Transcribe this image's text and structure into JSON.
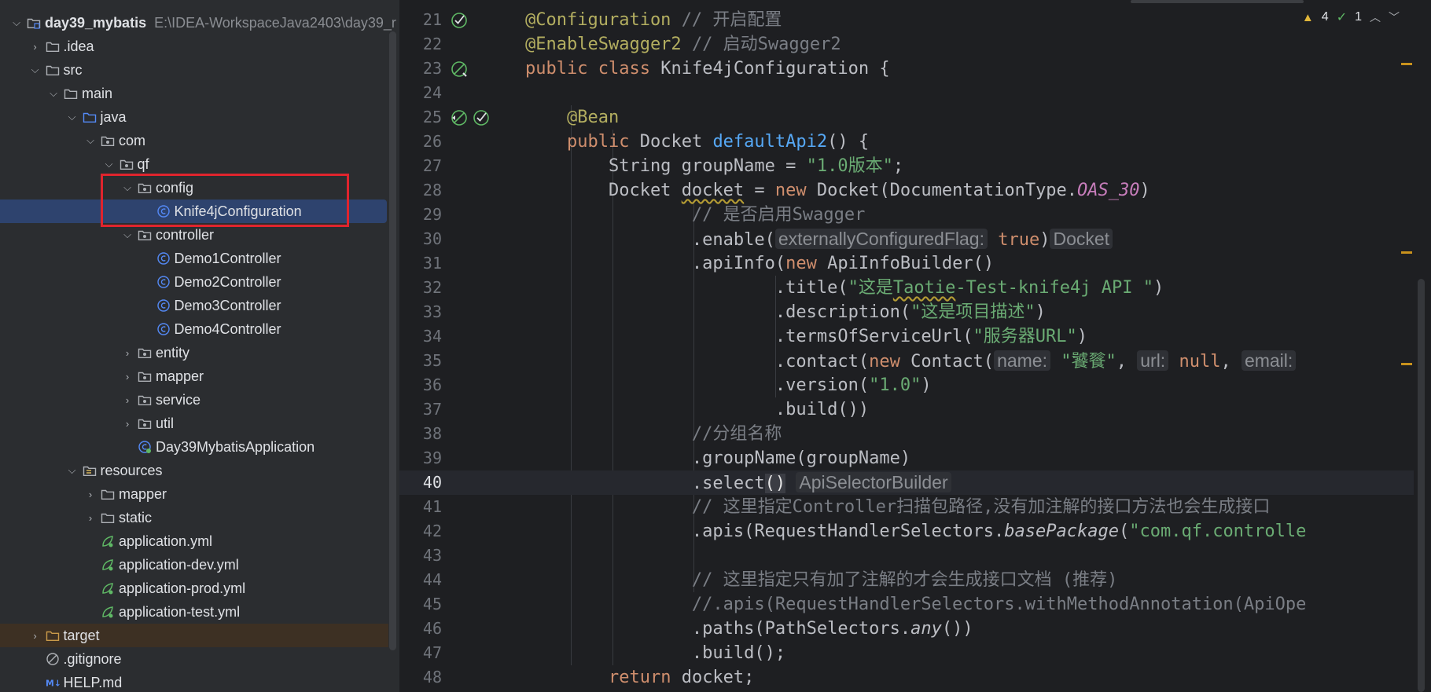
{
  "project": {
    "name": "day39_mybatis",
    "path": "E:\\IDEA-WorkspaceJava2403\\day39_r"
  },
  "tree": [
    {
      "label": "day39_mybatis",
      "indent": 0,
      "chevron": "down",
      "icon": "module-icon",
      "bold": true,
      "path": "E:\\IDEA-WorkspaceJava2403\\day39_r"
    },
    {
      "label": ".idea",
      "indent": 1,
      "chevron": "right",
      "icon": "folder-icon"
    },
    {
      "label": "src",
      "indent": 1,
      "chevron": "down",
      "icon": "folder-icon"
    },
    {
      "label": "main",
      "indent": 2,
      "chevron": "down",
      "icon": "folder-icon"
    },
    {
      "label": "java",
      "indent": 3,
      "chevron": "down",
      "icon": "source-folder-icon"
    },
    {
      "label": "com",
      "indent": 4,
      "chevron": "down",
      "icon": "package-icon"
    },
    {
      "label": "qf",
      "indent": 5,
      "chevron": "down",
      "icon": "package-icon"
    },
    {
      "label": "config",
      "indent": 6,
      "chevron": "down",
      "icon": "package-icon"
    },
    {
      "label": "Knife4jConfiguration",
      "indent": 7,
      "chevron": "none",
      "icon": "class-icon",
      "selected": true
    },
    {
      "label": "controller",
      "indent": 6,
      "chevron": "down",
      "icon": "package-icon"
    },
    {
      "label": "Demo1Controller",
      "indent": 7,
      "chevron": "none",
      "icon": "class-icon"
    },
    {
      "label": "Demo2Controller",
      "indent": 7,
      "chevron": "none",
      "icon": "class-icon"
    },
    {
      "label": "Demo3Controller",
      "indent": 7,
      "chevron": "none",
      "icon": "class-icon"
    },
    {
      "label": "Demo4Controller",
      "indent": 7,
      "chevron": "none",
      "icon": "class-icon"
    },
    {
      "label": "entity",
      "indent": 6,
      "chevron": "right",
      "icon": "package-icon"
    },
    {
      "label": "mapper",
      "indent": 6,
      "chevron": "right",
      "icon": "package-icon"
    },
    {
      "label": "service",
      "indent": 6,
      "chevron": "right",
      "icon": "package-icon"
    },
    {
      "label": "util",
      "indent": 6,
      "chevron": "right",
      "icon": "package-icon"
    },
    {
      "label": "Day39MybatisApplication",
      "indent": 6,
      "chevron": "none",
      "icon": "spring-class-icon"
    },
    {
      "label": "resources",
      "indent": 3,
      "chevron": "down",
      "icon": "resources-folder-icon"
    },
    {
      "label": "mapper",
      "indent": 4,
      "chevron": "right",
      "icon": "folder-icon"
    },
    {
      "label": "static",
      "indent": 4,
      "chevron": "right",
      "icon": "folder-icon"
    },
    {
      "label": "application.yml",
      "indent": 4,
      "chevron": "none",
      "icon": "yaml-icon"
    },
    {
      "label": "application-dev.yml",
      "indent": 4,
      "chevron": "none",
      "icon": "yaml-icon"
    },
    {
      "label": "application-prod.yml",
      "indent": 4,
      "chevron": "none",
      "icon": "yaml-icon"
    },
    {
      "label": "application-test.yml",
      "indent": 4,
      "chevron": "none",
      "icon": "yaml-icon"
    },
    {
      "label": "target",
      "indent": 1,
      "chevron": "right",
      "icon": "excluded-folder-icon",
      "excluded": true
    },
    {
      "label": ".gitignore",
      "indent": 1,
      "chevron": "none",
      "icon": "ignore-icon"
    },
    {
      "label": "HELP.md",
      "indent": 1,
      "chevron": "none",
      "icon": "markdown-icon"
    }
  ],
  "editor": {
    "status": {
      "warnings": "4",
      "checks": "1"
    },
    "current_line": 40,
    "lines": [
      {
        "n": "21",
        "gutter": [
          "bean-check-icon"
        ],
        "tokens": [
          [
            "@Configuration",
            "ann"
          ],
          [
            " ",
            "p"
          ],
          [
            "// 开启配置",
            "cm"
          ]
        ]
      },
      {
        "n": "22",
        "gutter": [],
        "tokens": [
          [
            "@EnableSwagger2",
            "ann"
          ],
          [
            " ",
            "p"
          ],
          [
            "// 启动Swagger2",
            "cm"
          ]
        ]
      },
      {
        "n": "23",
        "gutter": [
          "bean-config-icon"
        ],
        "tokens": [
          [
            "public",
            "kw"
          ],
          [
            " ",
            "p"
          ],
          [
            "class",
            "kw"
          ],
          [
            " Knife4jConfiguration {",
            "p"
          ]
        ]
      },
      {
        "n": "24",
        "gutter": [],
        "tokens": []
      },
      {
        "n": "25",
        "gutter": [
          "bean-nav-icon",
          "bean-check-icon"
        ],
        "tokens": [
          [
            "    ",
            "p"
          ],
          [
            "@Bean",
            "ann"
          ]
        ]
      },
      {
        "n": "26",
        "gutter": [],
        "tokens": [
          [
            "    ",
            "p"
          ],
          [
            "public",
            "kw"
          ],
          [
            " Docket ",
            "p"
          ],
          [
            "defaultApi2",
            "fn"
          ],
          [
            "() {",
            "p"
          ]
        ]
      },
      {
        "n": "27",
        "gutter": [],
        "tokens": [
          [
            "        String groupName = ",
            "p"
          ],
          [
            "\"1.0版本\"",
            "str"
          ],
          [
            ";",
            "p"
          ]
        ]
      },
      {
        "n": "28",
        "gutter": [],
        "tokens": [
          [
            "        Docket ",
            "p"
          ],
          [
            "docket",
            "sq"
          ],
          [
            " = ",
            "p"
          ],
          [
            "new",
            "kw"
          ],
          [
            " Docket(DocumentationType.",
            "p"
          ],
          [
            "OAS_30",
            "const"
          ],
          [
            ")",
            "p"
          ]
        ]
      },
      {
        "n": "29",
        "gutter": [],
        "tokens": [
          [
            "                ",
            "p"
          ],
          [
            "// 是否启用Swagger",
            "cm"
          ]
        ]
      },
      {
        "n": "30",
        "gutter": [],
        "tokens": [
          [
            "                .enable(",
            "p"
          ],
          [
            "externallyConfiguredFlag:",
            "hint"
          ],
          [
            " ",
            "p"
          ],
          [
            "true",
            "kw"
          ],
          [
            ")",
            "p"
          ],
          [
            "Docket",
            "hint"
          ]
        ]
      },
      {
        "n": "31",
        "gutter": [],
        "tokens": [
          [
            "                .apiInfo(",
            "p"
          ],
          [
            "new",
            "kw"
          ],
          [
            " ApiInfoBuilder()",
            "p"
          ]
        ]
      },
      {
        "n": "32",
        "gutter": [],
        "tokens": [
          [
            "                        .title(",
            "p"
          ],
          [
            "\"这是",
            "str"
          ],
          [
            "Taotie",
            "strsq"
          ],
          [
            "-Test-knife4j API \"",
            "str"
          ],
          [
            ")",
            "p"
          ]
        ]
      },
      {
        "n": "33",
        "gutter": [],
        "tokens": [
          [
            "                        .description(",
            "p"
          ],
          [
            "\"这是项目描述\"",
            "str"
          ],
          [
            ")",
            "p"
          ]
        ]
      },
      {
        "n": "34",
        "gutter": [],
        "tokens": [
          [
            "                        .termsOfServiceUrl(",
            "p"
          ],
          [
            "\"服务器URL\"",
            "str"
          ],
          [
            ")",
            "p"
          ]
        ]
      },
      {
        "n": "35",
        "gutter": [],
        "tokens": [
          [
            "                        .contact(",
            "p"
          ],
          [
            "new",
            "kw"
          ],
          [
            " Contact(",
            "p"
          ],
          [
            "name:",
            "hint"
          ],
          [
            " ",
            "p"
          ],
          [
            "\"饕餮\"",
            "str"
          ],
          [
            ", ",
            "p"
          ],
          [
            "url:",
            "hint"
          ],
          [
            " ",
            "p"
          ],
          [
            "null",
            "kw"
          ],
          [
            ", ",
            "p"
          ],
          [
            "email:",
            "hint"
          ]
        ]
      },
      {
        "n": "36",
        "gutter": [],
        "tokens": [
          [
            "                        .version(",
            "p"
          ],
          [
            "\"1.0\"",
            "str"
          ],
          [
            ")",
            "p"
          ]
        ]
      },
      {
        "n": "37",
        "gutter": [],
        "tokens": [
          [
            "                        .build())",
            "p"
          ]
        ]
      },
      {
        "n": "38",
        "gutter": [],
        "tokens": [
          [
            "                ",
            "p"
          ],
          [
            "//分组名称",
            "cm"
          ]
        ]
      },
      {
        "n": "39",
        "gutter": [],
        "tokens": [
          [
            "                .groupName(groupName)",
            "p"
          ]
        ]
      },
      {
        "n": "40",
        "gutter": [],
        "tokens": [
          [
            "                .select",
            "p"
          ],
          [
            "()",
            "br"
          ],
          [
            " ",
            "p"
          ],
          [
            "ApiSelectorBuilder",
            "hint"
          ]
        ]
      },
      {
        "n": "41",
        "gutter": [],
        "tokens": [
          [
            "                ",
            "p"
          ],
          [
            "// 这里指定Controller扫描包路径,没有加注解的接口方法也会生成接口",
            "cm"
          ]
        ]
      },
      {
        "n": "42",
        "gutter": [],
        "tokens": [
          [
            "                .apis(RequestHandlerSelectors.",
            "p"
          ],
          [
            "basePackage",
            "it"
          ],
          [
            "(",
            "p"
          ],
          [
            "\"com.qf.controlle",
            "str"
          ]
        ]
      },
      {
        "n": "43",
        "gutter": [],
        "tokens": []
      },
      {
        "n": "44",
        "gutter": [],
        "tokens": [
          [
            "                ",
            "p"
          ],
          [
            "// 这里指定只有加了注解的才会生成接口文档 (推荐)",
            "cm"
          ]
        ]
      },
      {
        "n": "45",
        "gutter": [],
        "tokens": [
          [
            "                ",
            "p"
          ],
          [
            "//.apis(RequestHandlerSelectors.withMethodAnnotation(ApiOpe",
            "cm"
          ]
        ]
      },
      {
        "n": "46",
        "gutter": [],
        "tokens": [
          [
            "                .paths(PathSelectors.",
            "p"
          ],
          [
            "any",
            "it"
          ],
          [
            "())",
            "p"
          ]
        ]
      },
      {
        "n": "47",
        "gutter": [],
        "tokens": [
          [
            "                .build();",
            "p"
          ]
        ]
      },
      {
        "n": "48",
        "gutter": [],
        "tokens": [
          [
            "        ",
            "p"
          ],
          [
            "return",
            "kw"
          ],
          [
            " docket;",
            "p"
          ]
        ]
      }
    ]
  },
  "colors": {
    "accent_selection": "#2e436e",
    "highlight_box": "#e0242d",
    "folder": "#aeb1b6",
    "source_folder": "#548af7",
    "class": "#548af7",
    "yaml": "#5fb865",
    "warning": "#e2b73a"
  }
}
